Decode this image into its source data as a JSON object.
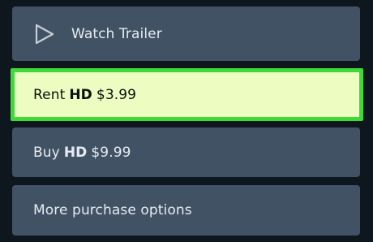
{
  "options": {
    "trailer": {
      "label": "Watch Trailer"
    },
    "rent": {
      "prefix": "Rent",
      "quality": "HD",
      "price": "$3.99"
    },
    "buy": {
      "prefix": "Buy",
      "quality": "HD",
      "price": "$9.99"
    },
    "more": {
      "label": "More purchase options"
    }
  },
  "icons": {
    "trailer": "play-icon"
  },
  "colors": {
    "background": "#0f171e",
    "option_bg": "#425265",
    "highlight_bg": "#edfdc1",
    "highlight_border": "#3edb38"
  }
}
